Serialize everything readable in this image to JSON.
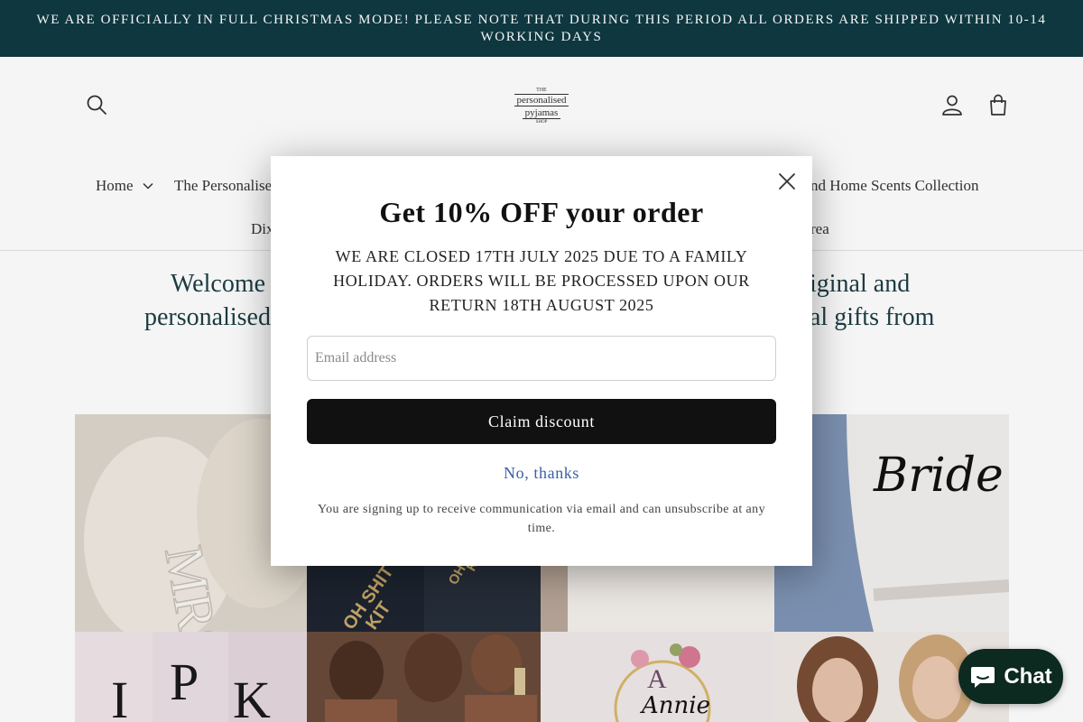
{
  "announcement": {
    "text": "WE ARE OFFICIALLY IN FULL CHRISTMAS MODE! PLEASE NOTE THAT DURING THIS PERIOD ALL ORDERS ARE SHIPPED WITHIN 10-14 WORKING DAYS"
  },
  "header": {
    "logo": {
      "top": "THE",
      "line1": "personalised",
      "line2": "pyjamas",
      "bottom": "SHOP"
    },
    "icons": {
      "search": "search-icon",
      "account": "user-icon",
      "cart": "bag-icon"
    }
  },
  "nav": {
    "home": "Home",
    "personalised": "The Personalise",
    "home_scents": "nd Home Scents Collection",
    "row2_left": "Dix",
    "row2_right": "rea"
  },
  "welcome": {
    "line1_left": "Welcome",
    "line1_right": "iginal and",
    "line2_left": "personalised",
    "line2_right": "al gifts from"
  },
  "popup": {
    "title": "Get 10% OFF your order",
    "notice": "WE ARE CLOSED 17TH JULY 2025 DUE TO A FAMILY HOLIDAY. ORDERS WILL BE PROCESSED UPON OUR RETURN 18TH AUGUST  2025",
    "email_placeholder": "Email address",
    "claim_label": "Claim discount",
    "decline_label": "No, thanks",
    "legal": "You are signing up to receive communication via email and can unsubscribe at any time."
  },
  "tiles": {
    "robe_script": "Bride",
    "slipper_letters": "MRS",
    "pyjama_text_1": "OH SHIT",
    "pyjama_text_2": "KIT",
    "pyjama_text_3": "OH SHIT",
    "pyjama_text_4": "KIT",
    "letters": [
      "I",
      "P",
      "K"
    ],
    "name_robe": "Annie",
    "name_letter": "A"
  },
  "chat": {
    "label": "Chat",
    "icon": "chat-bubble-icon"
  },
  "colors": {
    "announcement_bg": "#0f3a43",
    "button": "#111111",
    "link": "#3b5fa8",
    "chat_bg": "#0c2a20"
  }
}
